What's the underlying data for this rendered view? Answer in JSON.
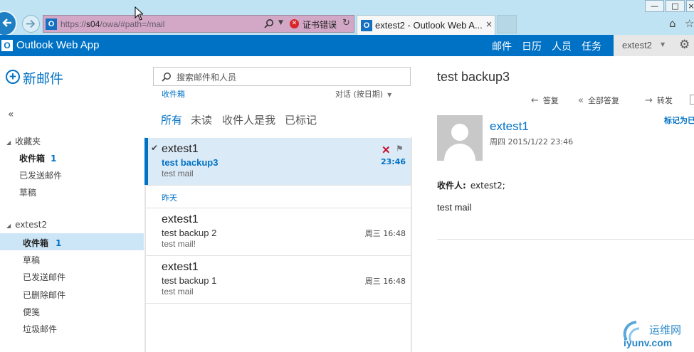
{
  "browser": {
    "url_prefix": "https://",
    "url_host": "s04",
    "url_path": "/owa/#path=/mail",
    "cert_error": "证书错误",
    "tab_title": "extest2 - Outlook Web A...",
    "tab_close": "×",
    "window_buttons": [
      "—",
      "□",
      "×"
    ],
    "icons": [
      "back-icon",
      "forward-icon",
      "search-icon",
      "refresh-icon",
      "home-icon",
      "favorites-icon"
    ]
  },
  "owa": {
    "app_name": "Outlook Web App",
    "nav": [
      "邮件",
      "日历",
      "人员",
      "任务"
    ],
    "user": "extest2",
    "brand_color": "#0072c6"
  },
  "sidebar": {
    "new_mail": "新邮件",
    "collapse": "«",
    "favorites_header": "收藏夹",
    "favorites": [
      {
        "label": "收件箱",
        "count": "1"
      },
      {
        "label": "已发送邮件",
        "count": ""
      },
      {
        "label": "草稿",
        "count": ""
      }
    ],
    "mailbox_header": "extest2",
    "folders": [
      {
        "label": "收件箱",
        "count": "1"
      },
      {
        "label": "草稿",
        "count": ""
      },
      {
        "label": "已发送邮件",
        "count": ""
      },
      {
        "label": "已删除邮件",
        "count": ""
      },
      {
        "label": "便笺",
        "count": ""
      },
      {
        "label": "垃圾邮件",
        "count": ""
      }
    ]
  },
  "list": {
    "search_placeholder": "搜索邮件和人员",
    "current_folder": "收件箱",
    "sort": "对话 (按日期)",
    "filters": [
      "所有",
      "未读",
      "收件人是我",
      "已标记"
    ],
    "group_yesterday": "昨天",
    "messages": [
      {
        "from": "extest1",
        "subject": "test backup3",
        "preview": "test mail",
        "time": "23:46",
        "unread": true,
        "selected": true
      },
      {
        "from": "extest1",
        "subject": "test backup 2",
        "preview": "test mail!",
        "time": "周三 16:48",
        "unread": false,
        "selected": false
      },
      {
        "from": "extest1",
        "subject": "test backup 1",
        "preview": "test mail",
        "time": "周三 16:48",
        "unread": false,
        "selected": false
      }
    ]
  },
  "reading": {
    "subject": "test backup3",
    "actions": [
      "答复",
      "全部答复",
      "转发"
    ],
    "from": "extest1",
    "date": "周四 2015/1/22 23:46",
    "mark_label": "标记为已",
    "to_label": "收件人:",
    "to_value": "extest2;",
    "body": "test mail"
  },
  "watermark": {
    "line1": "运维网",
    "line2": "iyunv.com"
  }
}
